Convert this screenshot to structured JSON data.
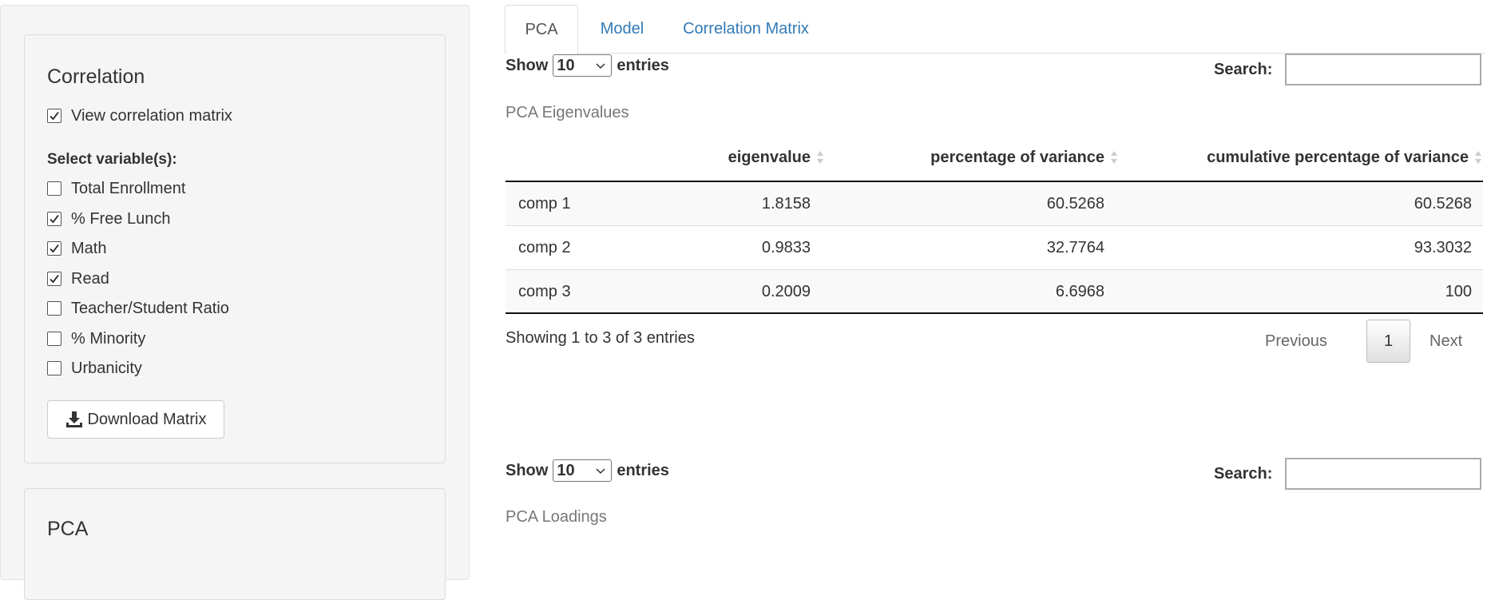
{
  "sidebar": {
    "correlation": {
      "title": "Correlation",
      "view_matrix": {
        "label": "View correlation matrix",
        "checked": true
      },
      "select_label": "Select variable(s):",
      "variables": [
        {
          "label": "Total Enrollment",
          "checked": false
        },
        {
          "label": "% Free Lunch",
          "checked": true
        },
        {
          "label": "Math",
          "checked": true
        },
        {
          "label": "Read",
          "checked": true
        },
        {
          "label": "Teacher/Student Ratio",
          "checked": false
        },
        {
          "label": "% Minority",
          "checked": false
        },
        {
          "label": "Urbanicity",
          "checked": false
        }
      ],
      "download_label": "Download Matrix"
    },
    "pca": {
      "title": "PCA"
    }
  },
  "tabs": [
    {
      "label": "PCA",
      "active": true
    },
    {
      "label": "Model",
      "active": false
    },
    {
      "label": "Correlation Matrix",
      "active": false
    }
  ],
  "eigen_table": {
    "show_label": "Show",
    "entries_value": "10",
    "entries_label": "entries",
    "search_label": "Search:",
    "search_value": "",
    "caption": "PCA Eigenvalues",
    "columns": [
      "",
      "eigenvalue",
      "percentage of variance",
      "cumulative percentage of variance"
    ],
    "rows": [
      [
        "comp 1",
        "1.8158",
        "60.5268",
        "60.5268"
      ],
      [
        "comp 2",
        "0.9833",
        "32.7764",
        "93.3032"
      ],
      [
        "comp 3",
        "0.2009",
        "6.6968",
        "100"
      ]
    ],
    "info": "Showing 1 to 3 of 3 entries",
    "pager": {
      "previous": "Previous",
      "page": "1",
      "next": "Next"
    }
  },
  "loadings_table": {
    "show_label": "Show",
    "entries_value": "10",
    "entries_label": "entries",
    "search_label": "Search:",
    "search_value": "",
    "caption": "PCA Loadings"
  },
  "colors": {
    "link": "#337ab7",
    "panel_bg": "#f5f5f5",
    "row_stripe": "#f9f9f9"
  }
}
